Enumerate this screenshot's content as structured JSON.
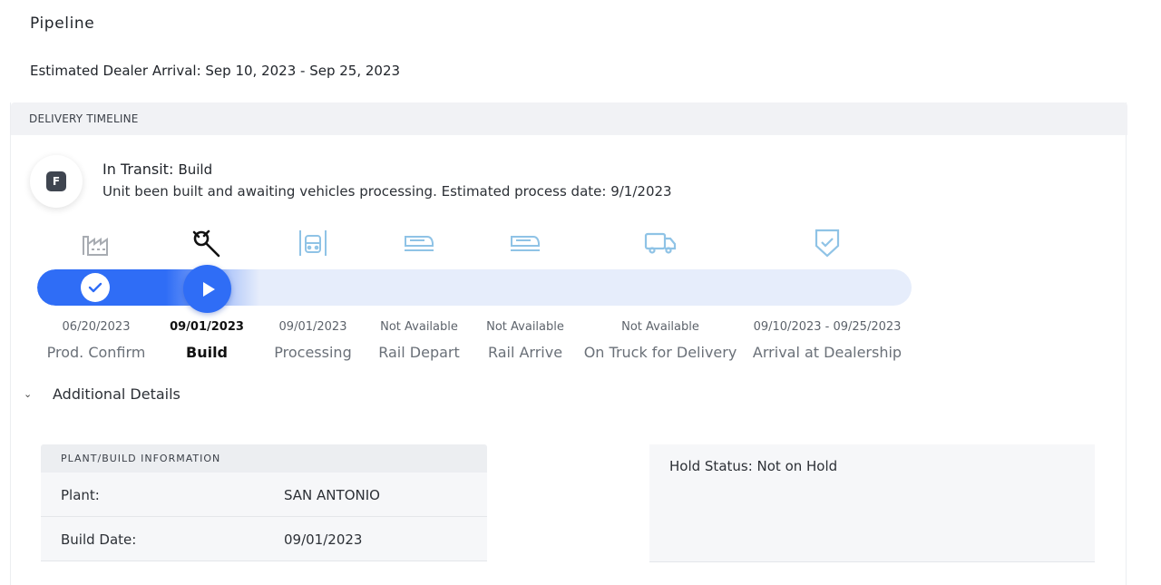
{
  "page": {
    "title": "Pipeline",
    "estimated_arrival": "Estimated Dealer Arrival: Sep 10, 2023 - Sep 25, 2023"
  },
  "timeline": {
    "header": "DELIVERY TIMELINE",
    "avatar_letter": "F",
    "status_prefix": "In Transit:",
    "status_stage": "Build",
    "status_description": "Unit been built and awaiting vehicles processing. Estimated process date: 9/1/2023",
    "progress_fraction": 0.25,
    "current_step_index": 1,
    "steps": [
      {
        "label": "Prod. Confirm",
        "date": "06/20/2023",
        "icon": "factory-icon",
        "state": "done"
      },
      {
        "label": "Build",
        "date": "09/01/2023",
        "icon": "wrench-icon",
        "state": "current"
      },
      {
        "label": "Processing",
        "date": "09/01/2023",
        "icon": "processing-icon",
        "state": "pending"
      },
      {
        "label": "Rail Depart",
        "date": "Not Available",
        "icon": "train-icon",
        "state": "pending"
      },
      {
        "label": "Rail Arrive",
        "date": "Not Available",
        "icon": "train-icon",
        "state": "pending"
      },
      {
        "label": "On Truck for Delivery",
        "date": "Not Available",
        "icon": "truck-icon",
        "state": "pending"
      },
      {
        "label": "Arrival at Dealership",
        "date": "09/10/2023 - 09/25/2023",
        "icon": "shield-check-icon",
        "state": "pending"
      }
    ]
  },
  "details": {
    "toggle_label": "Additional Details",
    "toggle_icon": "chevron-down-icon",
    "plant_header": "PLANT/BUILD INFORMATION",
    "plant_rows": [
      {
        "key": "Plant:",
        "value": "SAN ANTONIO"
      },
      {
        "key": "Build Date:",
        "value": "09/01/2023"
      }
    ],
    "hold_status": "Hold Status: Not on Hold"
  },
  "colors": {
    "accent": "#2f6df6",
    "track": "#e6edfb",
    "pending_icon": "#8fc3e6",
    "done_icon": "#a8acb2"
  }
}
